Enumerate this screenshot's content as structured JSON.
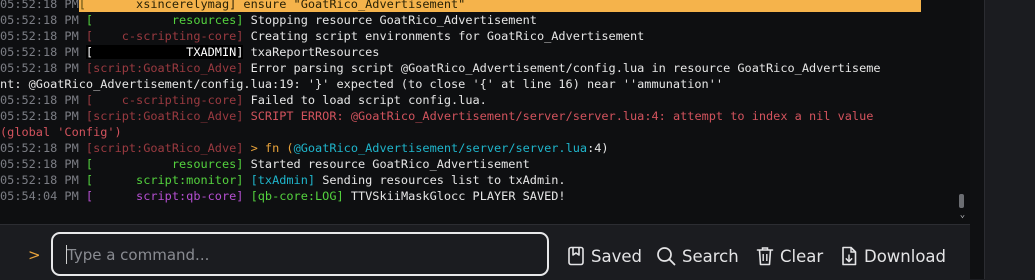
{
  "colors": {
    "timestamp": "#7b7d84",
    "text": "#e6e6e6",
    "highlight_bg": "#f5b34b",
    "error_text": "#d2535d",
    "channel_green": "#54d23e",
    "channel_red": "#9a3a40",
    "channel_purple": "#b54fd1",
    "channel_cyan": "#1fb5cb",
    "prompt": "#e9a33b"
  },
  "console": {
    "lines": [
      {
        "ts": "05:52:18 PM",
        "bo": "[",
        "ch": "       xsincerelymag]",
        "msg": " ensure \"GoatRico_Advertisement\"",
        "style": "highlight"
      },
      {
        "ts": "05:52:18 PM",
        "bo": "[",
        "ch": "           resources]",
        "msg": " Stopping resource GoatRico_Advertisement",
        "style": "green"
      },
      {
        "ts": "05:52:18 PM",
        "bo": "[",
        "ch": "    c-scripting-core]",
        "msg": " Creating script environments for GoatRico_Advertisement",
        "style": "red"
      },
      {
        "ts": "05:52:18 PM",
        "bo": "[",
        "ch": "             TXADMIN]",
        "msg": " txaReportResources",
        "style": "txadmin"
      },
      {
        "ts": "05:52:18 PM",
        "bo": "[",
        "ch": "script:GoatRico_Adve]",
        "msg": " Error parsing script @GoatRico_Advertisement/config.lua in resource GoatRico_Advertiseme",
        "style": "red"
      },
      {
        "ts": "",
        "bo": "",
        "ch": "",
        "msg": "nt: @GoatRico_Advertisement/config.lua:19: '}' expected (to close '{' at line 16) near ''ammunation''",
        "style": "cont"
      },
      {
        "ts": "05:52:18 PM",
        "bo": "[",
        "ch": "    c-scripting-core]",
        "msg": " Failed to load script config.lua.",
        "style": "red"
      },
      {
        "ts": "05:52:18 PM",
        "bo": "[",
        "ch": "script:GoatRico_Adve]",
        "msg": " SCRIPT ERROR: @GoatRico_Advertisement/server/server.lua:4: attempt to index a nil value",
        "style": "error"
      },
      {
        "ts": "",
        "bo": "",
        "ch": "",
        "msg": "(global 'Config')",
        "style": "error-cont"
      },
      {
        "ts": "05:52:18 PM",
        "bo": "[",
        "ch": "script:GoatRico_Adve]",
        "msg": " > fn (",
        "link": "@GoatRico_Advertisement/server/server.lua",
        "tail": ":4)",
        "style": "fn"
      },
      {
        "ts": "05:52:18 PM",
        "bo": "[",
        "ch": "           resources]",
        "msg": " Started resource GoatRico_Advertisement",
        "style": "green"
      },
      {
        "ts": "05:52:18 PM",
        "bo": "[",
        "ch": "      script:monitor]",
        "pre": " [txAdmin]",
        "msg": " Sending resources list to txAdmin.",
        "style": "monitor"
      },
      {
        "ts": "05:54:04 PM",
        "bo": "[",
        "ch": "      script:qb-core]",
        "pre": " [qb-core:LOG]",
        "msg": " TTVSkiiMaskGlocc PLAYER SAVED!",
        "style": "qbcore"
      }
    ]
  },
  "scroll": {
    "down_arrow": "⌄"
  },
  "command": {
    "prompt": ">",
    "placeholder": "Type a command..."
  },
  "toolbar": {
    "saved_label": "Saved",
    "search_label": "Search",
    "clear_label": "Clear",
    "download_label": "Download"
  }
}
